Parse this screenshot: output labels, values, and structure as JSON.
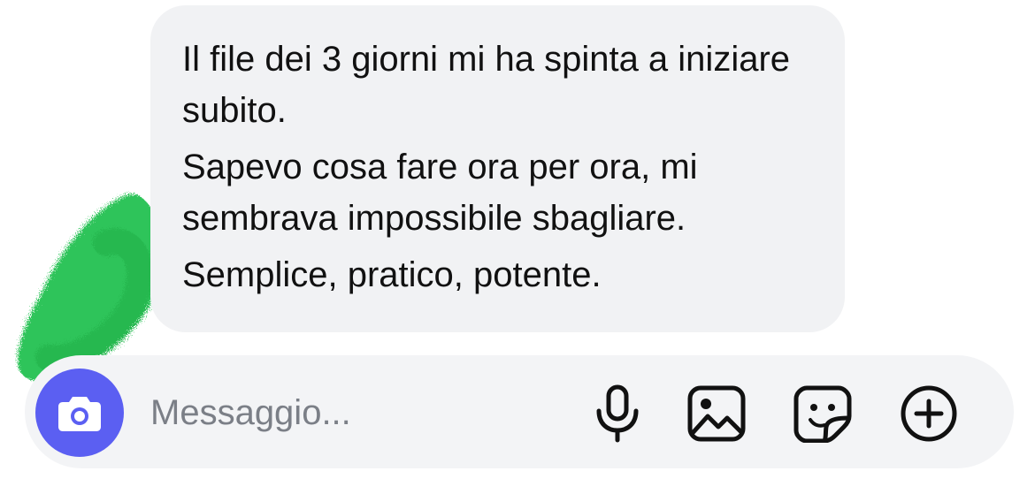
{
  "message": {
    "paragraphs": [
      "Il file dei 3 giorni mi ha spinta a iniziare subito.",
      "Sapevo cosa fare ora per ora, mi sembrava impossibile sbagliare.",
      "Semplice, pratico, potente."
    ]
  },
  "composer": {
    "placeholder": "Messaggio...",
    "camera_icon": "camera-icon",
    "tools": [
      "microphone-icon",
      "image-icon",
      "sticker-icon",
      "add-icon"
    ]
  },
  "colors": {
    "bubble_bg": "#f1f2f4",
    "camera_button": "#5b5ff2",
    "scribble": "#2fc45a",
    "placeholder_text": "#7b7f87"
  }
}
